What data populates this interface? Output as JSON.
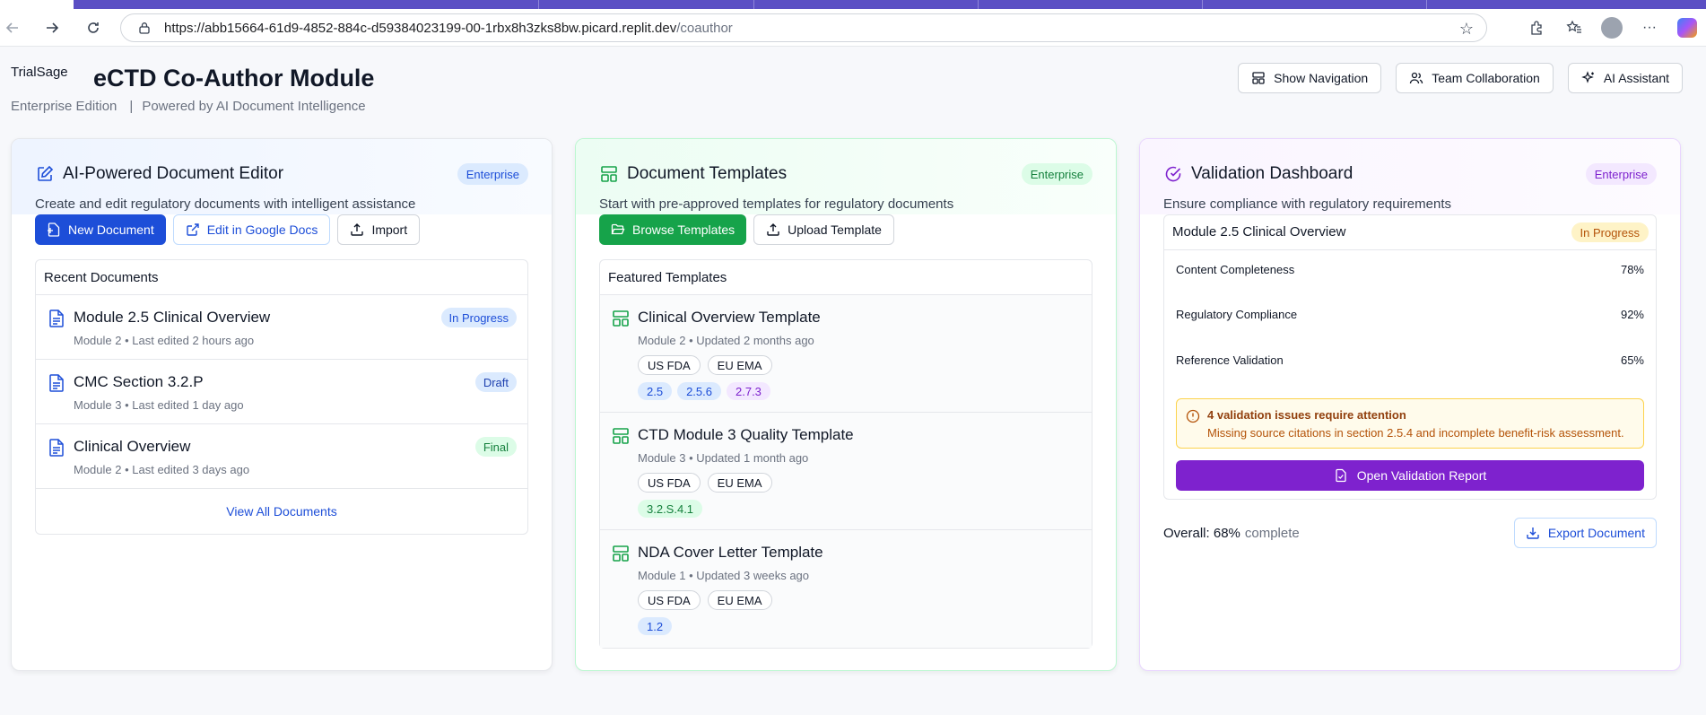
{
  "browser": {
    "url_base": "https://abb15664-61d9-4852-884c-d59384023199-00-1rbx8h3zks8bw.picard.replit.dev",
    "url_path": "/coauthor"
  },
  "header": {
    "logo_alt": "TrialSage",
    "title": "eCTD Co-Author Module",
    "edition": "Enterprise Edition",
    "separator": "|",
    "powered_by": "Powered by AI Document Intelligence",
    "buttons": {
      "navigation": "Show Navigation",
      "collaboration": "Team Collaboration",
      "assistant": "AI Assistant"
    }
  },
  "editor": {
    "title": "AI-Powered Document Editor",
    "badge": "Enterprise",
    "subtitle": "Create and edit regulatory documents with intelligent assistance",
    "actions": {
      "new": "New Document",
      "google": "Edit in Google Docs",
      "import": "Import"
    },
    "recent_heading": "Recent Documents",
    "documents": [
      {
        "name": "Module 2.5 Clinical Overview",
        "meta": "Module 2 • Last edited 2 hours ago",
        "status": "In Progress"
      },
      {
        "name": "CMC Section 3.2.P",
        "meta": "Module 3 • Last edited 1 day ago",
        "status": "Draft"
      },
      {
        "name": "Clinical Overview",
        "meta": "Module 2 • Last edited 3 days ago",
        "status": "Final"
      }
    ],
    "view_all": "View All Documents"
  },
  "templates": {
    "title": "Document Templates",
    "badge": "Enterprise",
    "subtitle": "Start with pre-approved templates for regulatory documents",
    "actions": {
      "browse": "Browse Templates",
      "upload": "Upload Template"
    },
    "featured_heading": "Featured Templates",
    "items": [
      {
        "name": "Clinical Overview Template",
        "meta": "Module 2 • Updated 2 months ago",
        "regions": [
          "US FDA",
          "EU EMA"
        ],
        "sections": [
          "2.5",
          "2.5.6",
          "2.7.3"
        ]
      },
      {
        "name": "CTD Module 3 Quality Template",
        "meta": "Module 3 • Updated 1 month ago",
        "regions": [
          "US FDA",
          "EU EMA"
        ],
        "sections": [
          "3.2.S.4.1"
        ]
      },
      {
        "name": "NDA Cover Letter Template",
        "meta": "Module 1 • Updated 3 weeks ago",
        "regions": [
          "US FDA",
          "EU EMA"
        ],
        "sections": [
          "1.2"
        ]
      }
    ]
  },
  "validation": {
    "title": "Validation Dashboard",
    "badge": "Enterprise",
    "subtitle": "Ensure compliance with regulatory requirements",
    "document": "Module 2.5 Clinical Overview",
    "status": "In Progress",
    "metrics": [
      {
        "label": "Content Completeness",
        "value": "78%"
      },
      {
        "label": "Regulatory Compliance",
        "value": "92%"
      },
      {
        "label": "Reference Validation",
        "value": "65%"
      }
    ],
    "alert_title": "4 validation issues require attention",
    "alert_desc": "Missing source citations in section 2.5.4 and incomplete benefit-risk assessment.",
    "open_report": "Open Validation Report",
    "overall_label": "Overall: 68%",
    "overall_suffix": "complete",
    "export": "Export Document"
  },
  "colors": {
    "primary_blue": "#1d4ed8",
    "primary_green": "#16a34a",
    "primary_purple": "#7e22ce",
    "warning_bg": "#fffbeb",
    "tab_strip": "#5b4fc4"
  },
  "icons": {
    "back": "arrow-left-icon",
    "forward": "arrow-right-icon",
    "refresh": "refresh-icon",
    "lock": "site-info-icon",
    "favorite": "star-icon",
    "extensions": "puzzle-icon",
    "favorites": "favorites-icon",
    "profile": "profile-icon",
    "menu": "more-icon",
    "copilot": "copilot-icon"
  }
}
